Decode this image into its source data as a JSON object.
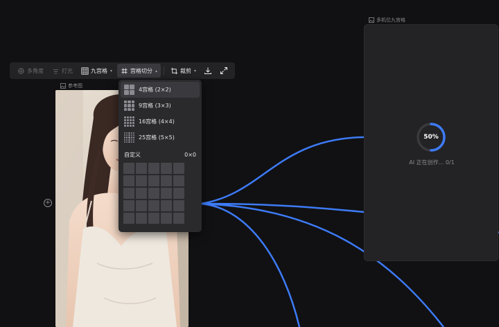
{
  "toolbar": {
    "multi_angle": "多角度",
    "lighting": "打光",
    "nine_grid": "九宫格",
    "grid_split": "宫格切分",
    "crop": "裁剪",
    "download_icon": "download-icon",
    "expand_icon": "expand-icon"
  },
  "reference_node": {
    "caption": "参考图",
    "icon": "image-icon"
  },
  "grid_menu": {
    "items": [
      {
        "label": "4宫格 (2×2)",
        "cols": 2,
        "selected": true
      },
      {
        "label": "9宫格 (3×3)",
        "cols": 3,
        "selected": false
      },
      {
        "label": "16宫格 (4×4)",
        "cols": 4,
        "selected": false
      },
      {
        "label": "25宫格 (5×5)",
        "cols": 5,
        "selected": false
      }
    ],
    "custom_label": "自定义",
    "custom_value": "0×0",
    "custom_grid_size": 5
  },
  "result_node": {
    "caption": "多机位九宫格",
    "progress": 0.5,
    "progress_label": "50%",
    "status": "AI 正在创作... 0/1"
  },
  "colors": {
    "background": "#111113",
    "accent": "#3d7bf7",
    "panel": "#232325",
    "menu": "#2a2a2d"
  }
}
